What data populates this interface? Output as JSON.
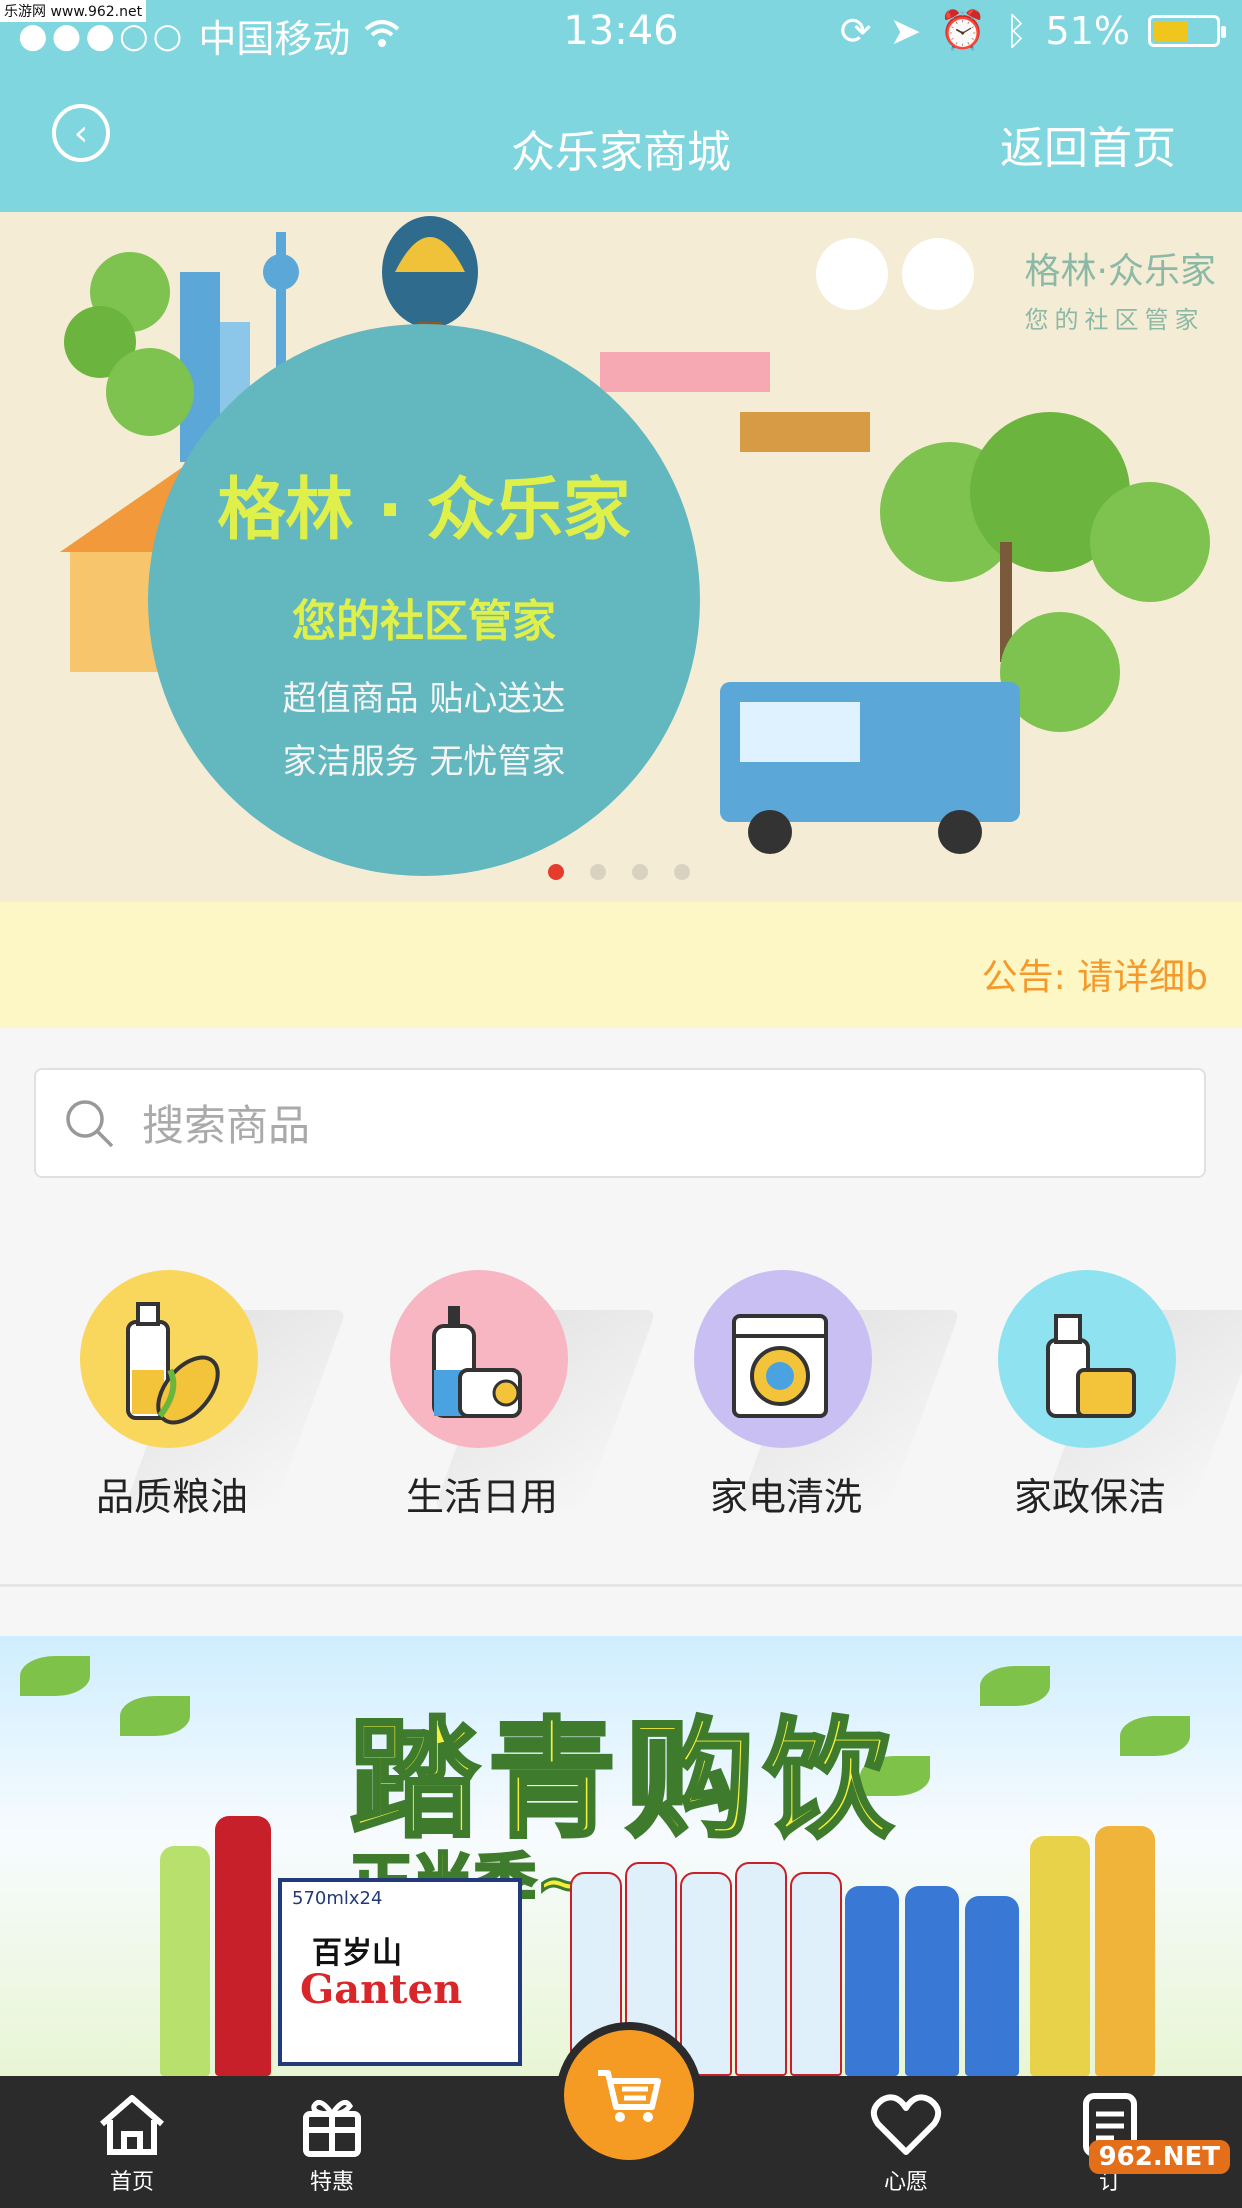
{
  "status_bar": {
    "carrier": "中国移动",
    "time": "13:46",
    "battery": "51%",
    "battery_level": 0.51,
    "watermark": "乐游网 www.962.net"
  },
  "nav": {
    "title": "众乐家商城",
    "home_label": "返回首页"
  },
  "banner": {
    "title": "格林 · 众乐家",
    "subtitle": "您的社区管家",
    "line1": "超值商品  贴心送达",
    "line2": "家洁服务  无忧管家",
    "brand_title": "格林·众乐家",
    "brand_sub": "您的社区管家",
    "slide_count": 4,
    "active_slide": 1
  },
  "notice": {
    "text": "公告:  请详细b"
  },
  "search": {
    "placeholder": "搜索商品"
  },
  "categories": [
    {
      "label": "品质粮油",
      "color": "#f9d65c"
    },
    {
      "label": "生活日用",
      "color": "#f7b6c1"
    },
    {
      "label": "家电清洗",
      "color": "#c9bff3"
    },
    {
      "label": "家政保洁",
      "color": "#8fe3f0"
    }
  ],
  "promo": {
    "title": "踏青购饮",
    "subtitle": "正当季~",
    "box_top": "570mlx24",
    "box_brand": "百岁山",
    "box_logo": "Ganten"
  },
  "tabbar": {
    "items": [
      {
        "label": "首页",
        "icon": "home-icon"
      },
      {
        "label": "特惠",
        "icon": "gift-icon"
      },
      {
        "label": "",
        "icon": "cart-icon"
      },
      {
        "label": "心愿",
        "icon": "heart-icon"
      },
      {
        "label": "订",
        "icon": "order-icon"
      }
    ],
    "watermark": "962.NET"
  }
}
